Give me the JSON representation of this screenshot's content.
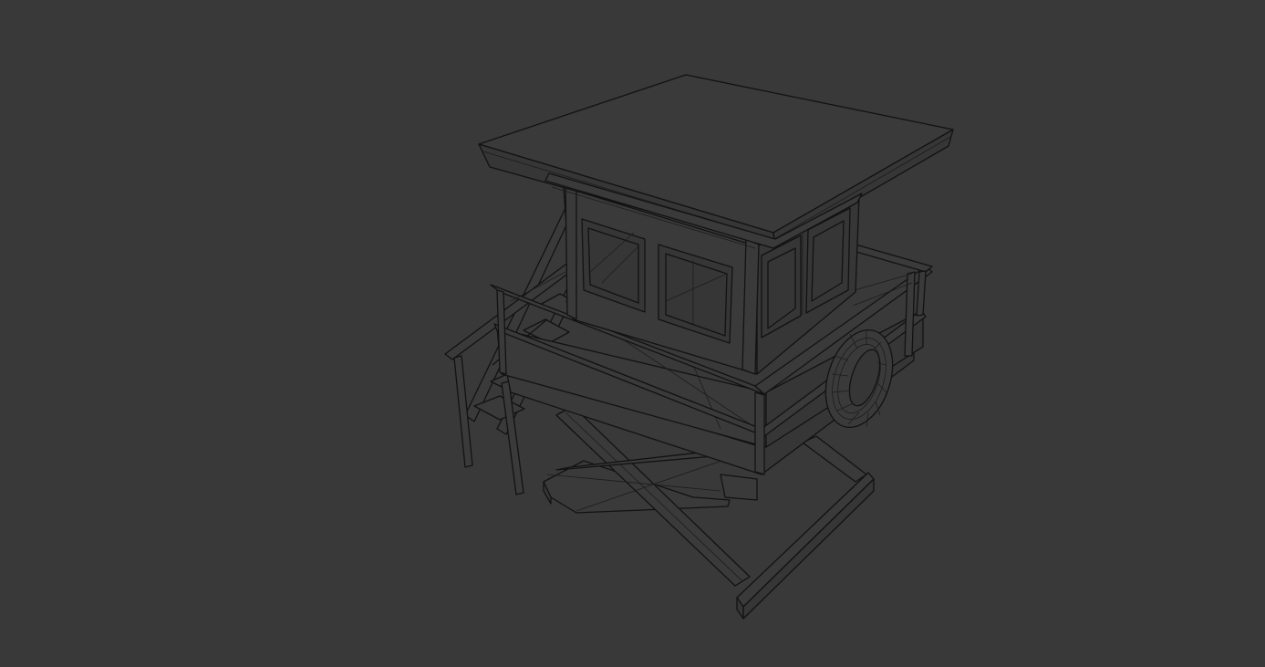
{
  "viewport": {
    "background_color": "#393939",
    "wire_color": "#121212",
    "subject": "lifeguard-tower-wireframe"
  }
}
